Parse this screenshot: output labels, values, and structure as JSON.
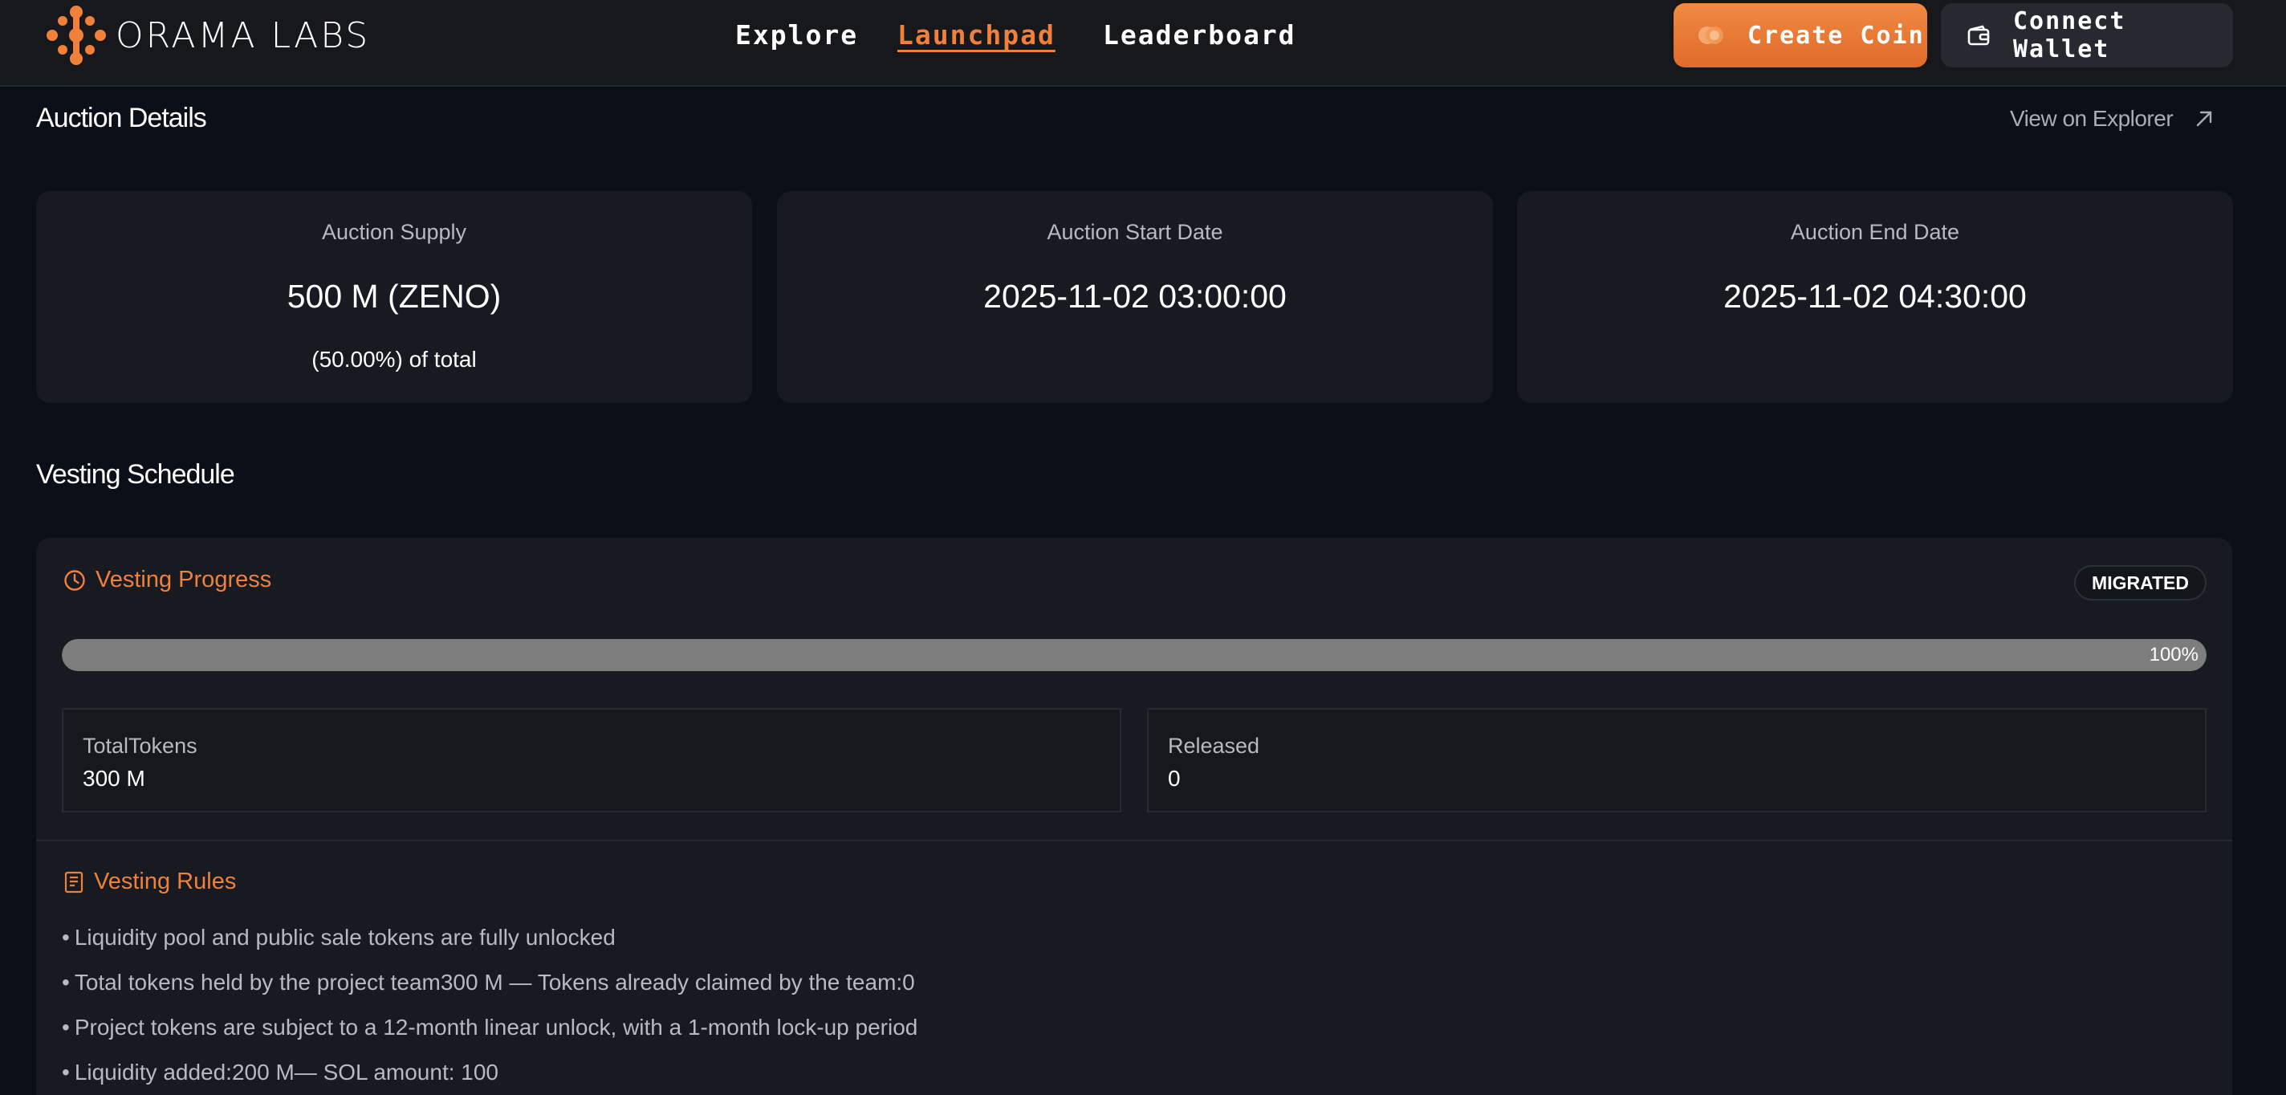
{
  "header": {
    "logo_text": "ORAMA LABS",
    "nav": [
      {
        "label": "Explore",
        "active": false
      },
      {
        "label": "Launchpad",
        "active": true
      },
      {
        "label": "Leaderboard",
        "active": false
      }
    ],
    "create_coin_label": "Create Coin",
    "connect_wallet_label": "Connect Wallet"
  },
  "auction": {
    "title": "Auction Details",
    "explorer_link": "View on Explorer",
    "cards": [
      {
        "label": "Auction Supply",
        "value": "500 M (ZENO)",
        "sub": "(50.00%) of total"
      },
      {
        "label": "Auction Start Date",
        "value": "2025-11-02 03:00:00",
        "sub": ""
      },
      {
        "label": "Auction End Date",
        "value": "2025-11-02 04:30:00",
        "sub": ""
      }
    ]
  },
  "vesting": {
    "title": "Vesting Schedule",
    "progress_title": "Vesting Progress",
    "status_badge": "MIGRATED",
    "progress_percent": 100,
    "progress_label": "100%",
    "stats": [
      {
        "label": "TotalTokens",
        "value": "300 M"
      },
      {
        "label": "Released",
        "value": "0"
      }
    ],
    "rules_title": "Vesting Rules",
    "rules": [
      "Liquidity pool and public sale tokens are fully unlocked",
      "Total tokens held by the project team300 M — Tokens already claimed by the team:0",
      "Project tokens are subject to a 12-month linear unlock, with a 1-month lock-up period",
      "Liquidity added:200 M— SOL amount: 100"
    ]
  },
  "colors": {
    "accent": "#f0803a",
    "background": "#0b0f18",
    "card": "#171a20",
    "progress_fill": "#7d7d7d"
  },
  "icons": {
    "logo": "orama-logo-icon",
    "create_coin": "coin-icon",
    "connect_wallet": "wallet-icon",
    "explorer": "external-arrow-icon",
    "progress": "clock-icon",
    "rules": "document-icon"
  }
}
